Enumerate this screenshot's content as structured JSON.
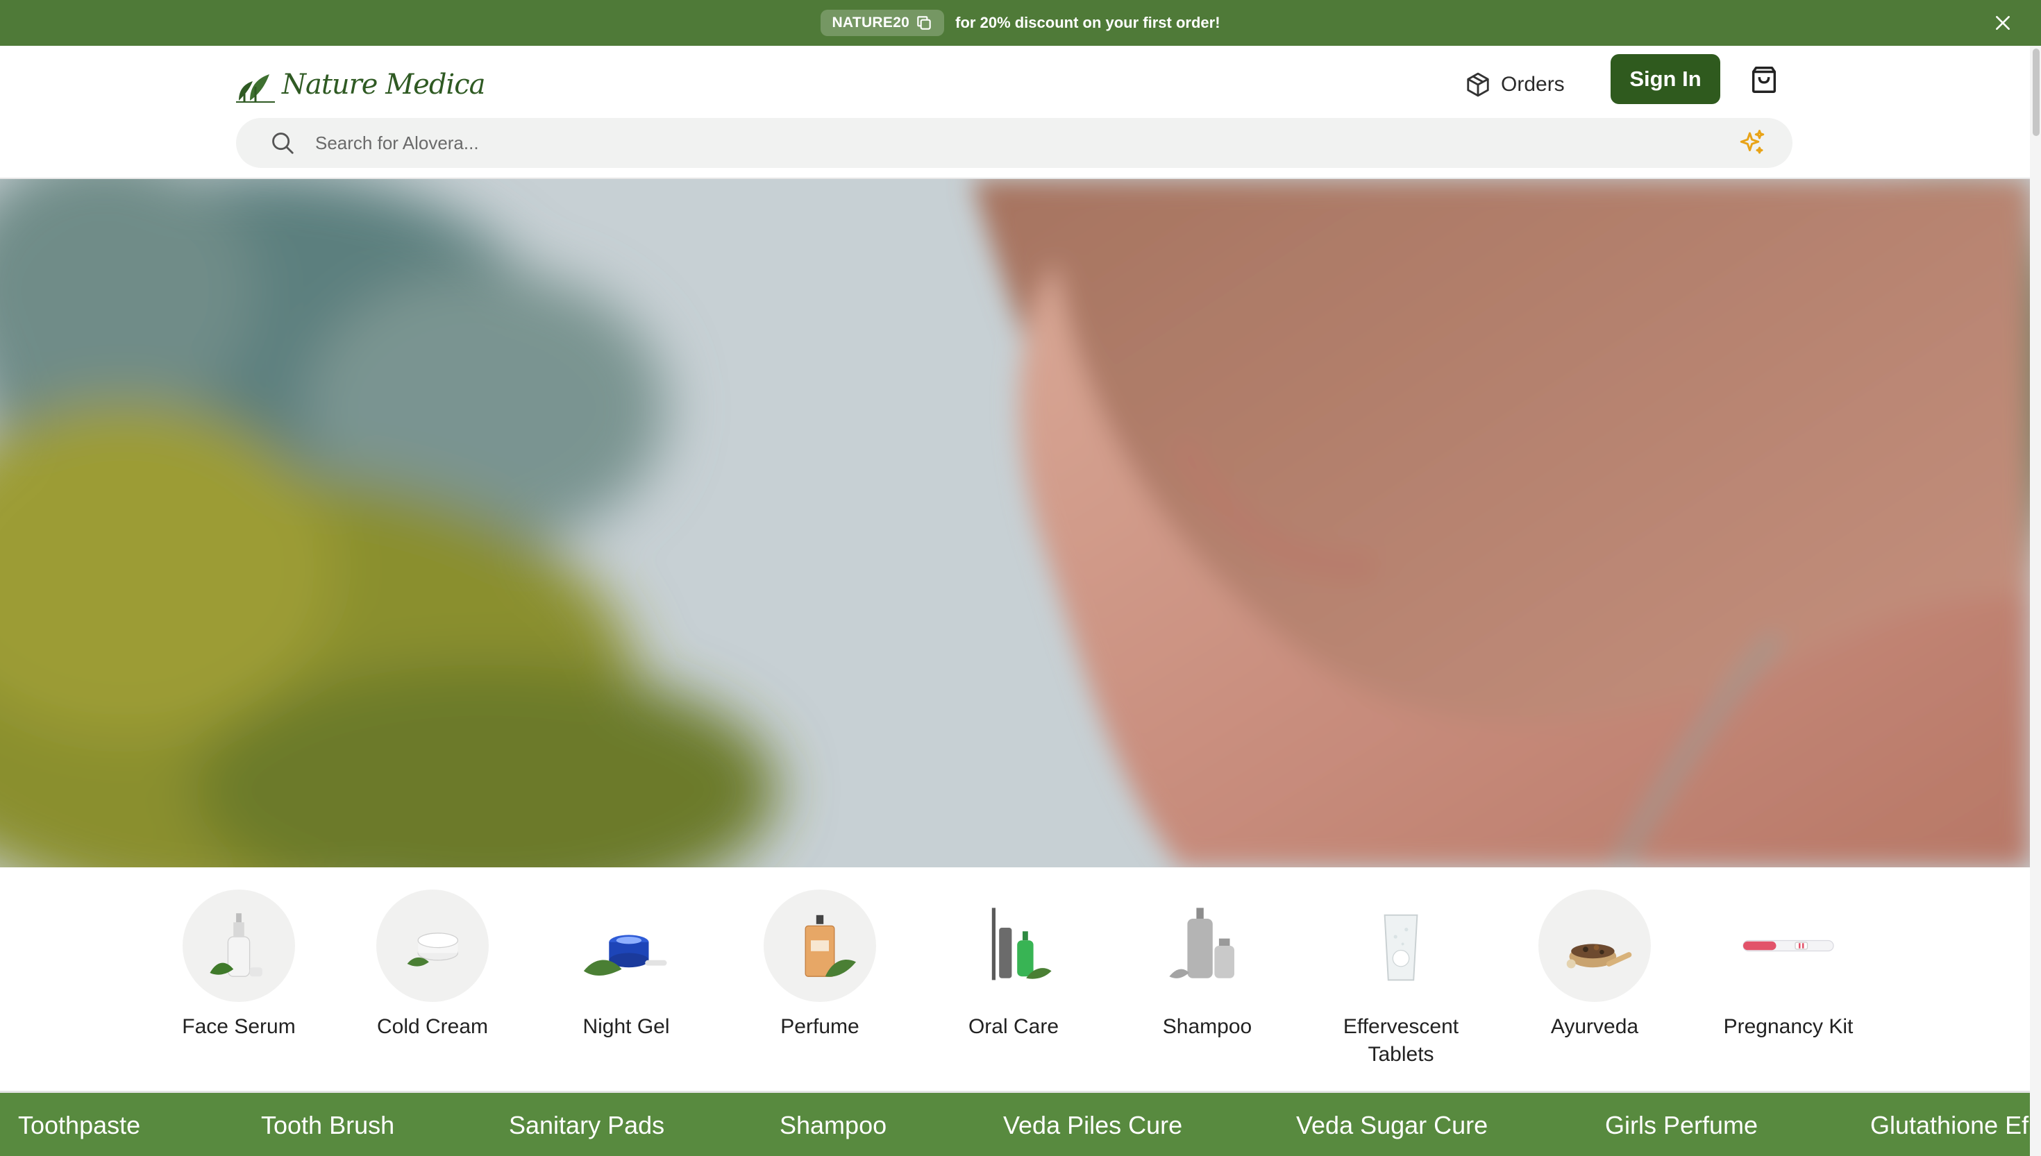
{
  "promo": {
    "code": "NATURE20",
    "text": "for 20% discount on your first order!"
  },
  "header": {
    "logo_text": "Nature Medica",
    "orders_label": "Orders",
    "signin_label": "Sign In"
  },
  "search": {
    "placeholder": "Search for Alovera..."
  },
  "categories": [
    {
      "label": "Face Serum"
    },
    {
      "label": "Cold Cream"
    },
    {
      "label": "Night Gel"
    },
    {
      "label": "Perfume"
    },
    {
      "label": "Oral Care"
    },
    {
      "label": "Shampoo"
    },
    {
      "label": "Effervescent Tablets"
    },
    {
      "label": "Ayurveda"
    },
    {
      "label": "Pregnancy Kit"
    }
  ],
  "ticker": [
    {
      "label": "Toothpaste"
    },
    {
      "label": "Tooth Brush"
    },
    {
      "label": "Sanitary Pads"
    },
    {
      "label": "Shampoo"
    },
    {
      "label": "Veda Piles Cure"
    },
    {
      "label": "Veda Sugar Cure"
    },
    {
      "label": "Girls Perfume"
    },
    {
      "label": "Glutathione Ef"
    }
  ],
  "colors": {
    "promo_bg": "#4f7a38",
    "brand_dark": "#2f5a1e",
    "ticker_bg": "#588a3f",
    "ai_accent": "#e8a317"
  },
  "icons": {
    "copy": "copy-icon",
    "close": "close-icon",
    "orders": "package-icon",
    "cart": "shopping-bag-icon",
    "search": "search-icon",
    "ai": "sparkle-icon"
  }
}
